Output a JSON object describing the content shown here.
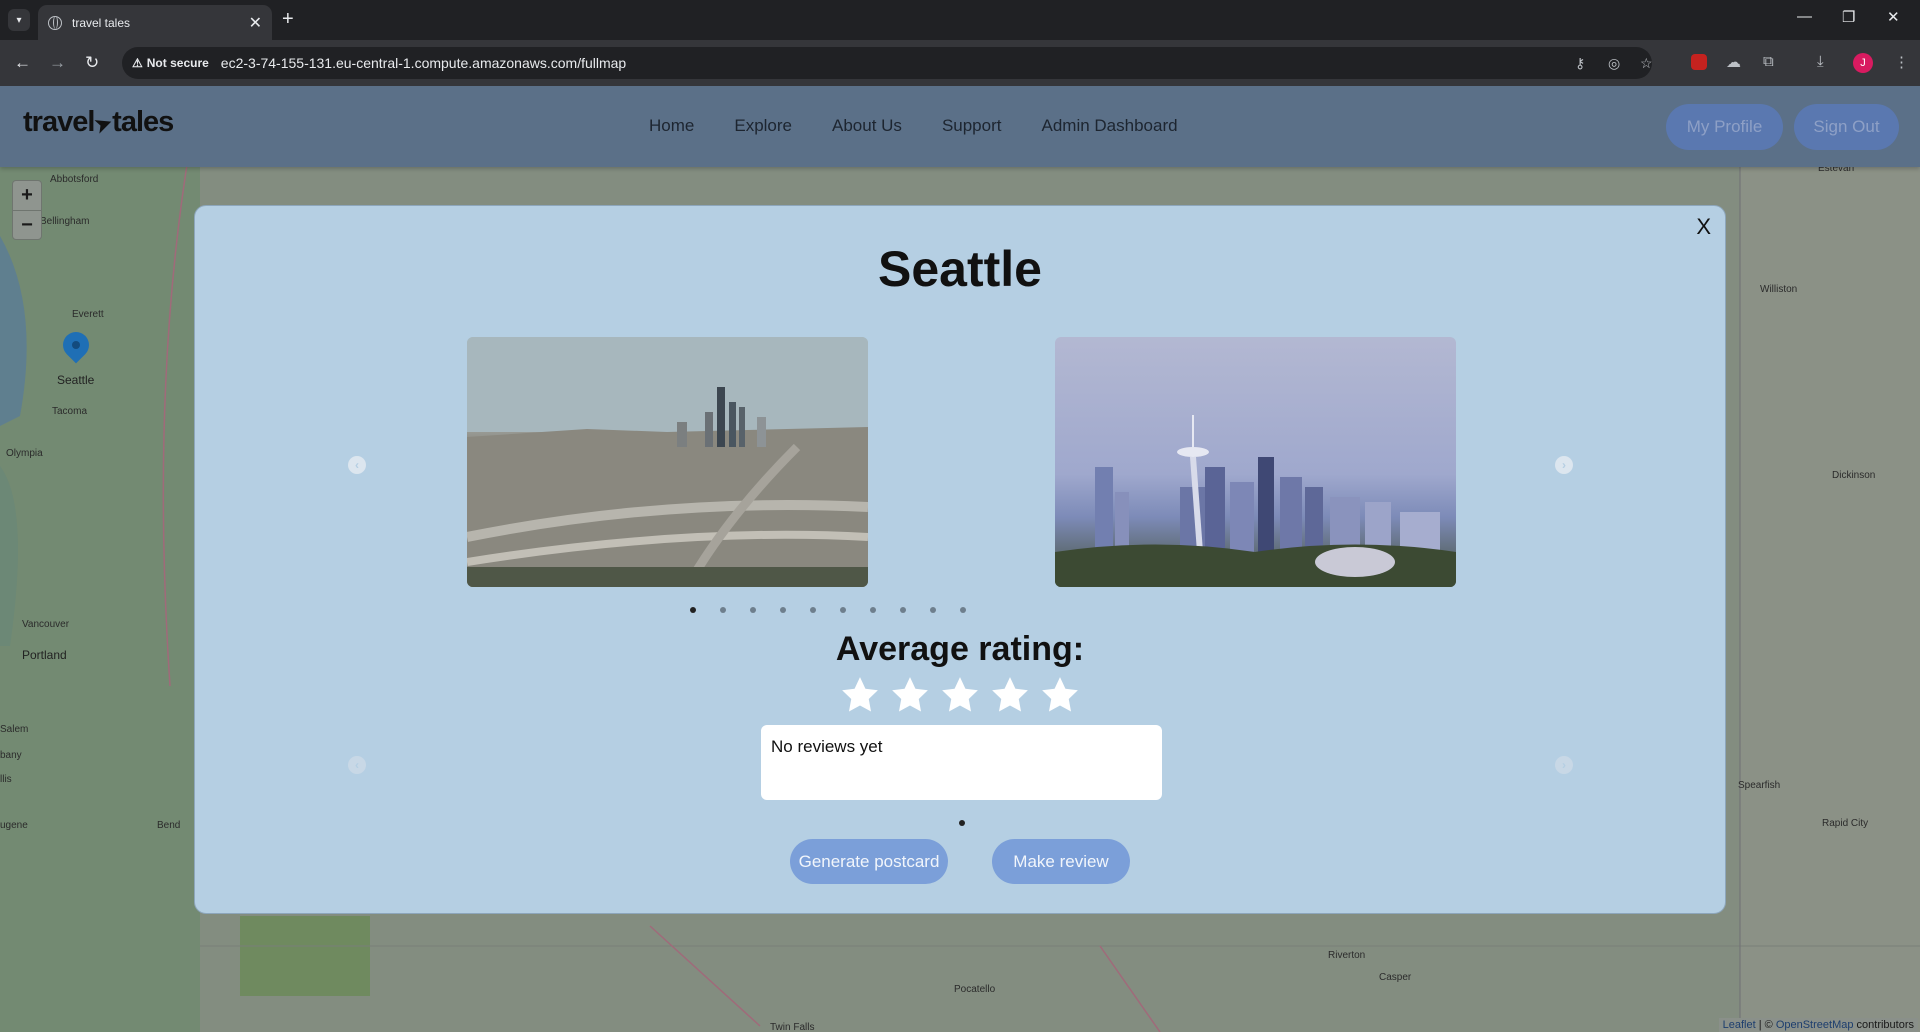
{
  "browser": {
    "tab_title": "travel tales",
    "not_secure_label": "Not secure",
    "url": "ec2-3-74-155-131.eu-central-1.compute.amazonaws.com/fullmap",
    "avatar_initial": "J"
  },
  "header": {
    "logo_left": "travel",
    "logo_right": "tales",
    "nav": [
      "Home",
      "Explore",
      "About Us",
      "Support",
      "Admin Dashboard"
    ],
    "my_profile": "My Profile",
    "sign_out": "Sign Out"
  },
  "map": {
    "zoom_in": "+",
    "zoom_out": "−",
    "labels": [
      "Abbotsford",
      "Bellingham",
      "Everett",
      "Seattle",
      "Tacoma",
      "Olympia",
      "Vancouver",
      "Portland",
      "Salem",
      "bany",
      "llis",
      "ugene",
      "Bend",
      "Estevan",
      "Williston",
      "Dickinson",
      "Spearfish",
      "Rapid City",
      "Riverton",
      "Casper",
      "Pocatello",
      "Twin Falls"
    ],
    "attribution_leaflet": "Leaflet",
    "attribution_sep": " | © ",
    "attribution_osm": "OpenStreetMap",
    "attribution_tail": " contributors"
  },
  "modal": {
    "close": "X",
    "city": "Seattle",
    "image_count": 10,
    "active_image": 0,
    "rating_title": "Average rating:",
    "rating_value": 0,
    "rating_max": 5,
    "review_text": "No reviews yet",
    "postcard_button": "Generate postcard",
    "review_button": "Make review"
  },
  "colors": {
    "header_bg": "#5b7088",
    "modal_bg": "#b5cfe3",
    "button_bg": "#7b9fd9",
    "marker": "#1f6fb5"
  },
  "icons": [
    "tab-menu-icon",
    "favicon-icon",
    "close-tab-icon",
    "new-tab-icon",
    "back-icon",
    "forward-icon",
    "reload-icon",
    "warning-icon",
    "key-icon",
    "eye-off-icon",
    "star-bookmark-icon",
    "extension-icon",
    "download-icon",
    "kebab-menu-icon",
    "map-marker-icon",
    "chevron-left-icon",
    "chevron-right-icon",
    "rating-star-icon"
  ]
}
